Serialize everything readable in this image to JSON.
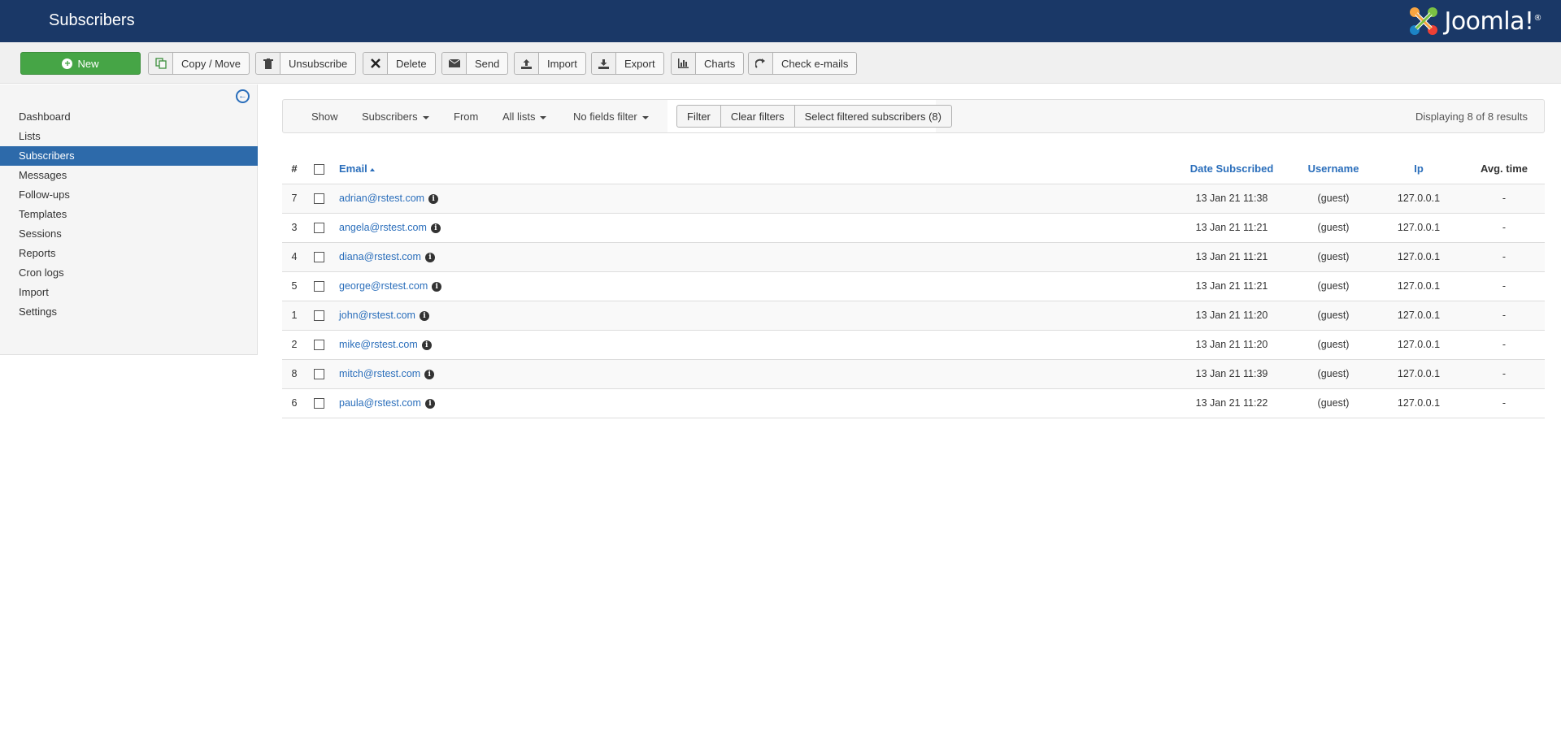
{
  "header": {
    "title": "Subscribers",
    "logo_text": "Joomla!",
    "logo_reg": "®"
  },
  "toolbar": {
    "new_label": "New",
    "copy_move_label": "Copy / Move",
    "unsubscribe_label": "Unsubscribe",
    "delete_label": "Delete",
    "send_label": "Send",
    "import_label": "Import",
    "export_label": "Export",
    "charts_label": "Charts",
    "check_emails_label": "Check e-mails"
  },
  "sidebar": {
    "items": [
      {
        "label": "Dashboard"
      },
      {
        "label": "Lists"
      },
      {
        "label": "Subscribers"
      },
      {
        "label": "Messages"
      },
      {
        "label": "Follow-ups"
      },
      {
        "label": "Templates"
      },
      {
        "label": "Sessions"
      },
      {
        "label": "Reports"
      },
      {
        "label": "Cron logs"
      },
      {
        "label": "Import"
      },
      {
        "label": "Settings"
      }
    ],
    "active": "Subscribers"
  },
  "filters": {
    "show_label": "Show",
    "subscribers_dropdown": "Subscribers",
    "from_label": "From",
    "all_lists_dropdown": "All lists",
    "fields_filter_dropdown": "No fields filter",
    "filter_button": "Filter",
    "clear_filters_button": "Clear filters",
    "select_filtered_button": "Select filtered subscribers (8)",
    "displaying": "Displaying 8 of 8 results"
  },
  "table": {
    "headers": {
      "num": "#",
      "email": "Email",
      "date": "Date Subscribed",
      "username": "Username",
      "ip": "Ip",
      "avg_time": "Avg. time"
    },
    "rows": [
      {
        "id": "7",
        "email": "adrian@rstest.com",
        "date": "13 Jan 21 11:38",
        "username": "(guest)",
        "ip": "127.0.0.1",
        "avg": "-"
      },
      {
        "id": "3",
        "email": "angela@rstest.com",
        "date": "13 Jan 21 11:21",
        "username": "(guest)",
        "ip": "127.0.0.1",
        "avg": "-"
      },
      {
        "id": "4",
        "email": "diana@rstest.com",
        "date": "13 Jan 21 11:21",
        "username": "(guest)",
        "ip": "127.0.0.1",
        "avg": "-"
      },
      {
        "id": "5",
        "email": "george@rstest.com",
        "date": "13 Jan 21 11:21",
        "username": "(guest)",
        "ip": "127.0.0.1",
        "avg": "-"
      },
      {
        "id": "1",
        "email": "john@rstest.com",
        "date": "13 Jan 21 11:20",
        "username": "(guest)",
        "ip": "127.0.0.1",
        "avg": "-"
      },
      {
        "id": "2",
        "email": "mike@rstest.com",
        "date": "13 Jan 21 11:20",
        "username": "(guest)",
        "ip": "127.0.0.1",
        "avg": "-"
      },
      {
        "id": "8",
        "email": "mitch@rstest.com",
        "date": "13 Jan 21 11:39",
        "username": "(guest)",
        "ip": "127.0.0.1",
        "avg": "-"
      },
      {
        "id": "6",
        "email": "paula@rstest.com",
        "date": "13 Jan 21 11:22",
        "username": "(guest)",
        "ip": "127.0.0.1",
        "avg": "-"
      }
    ]
  },
  "colors": {
    "header_bg": "#1a3867",
    "new_button": "#46a546",
    "active_nav": "#2d6aaa",
    "link": "#2a6ebb"
  }
}
